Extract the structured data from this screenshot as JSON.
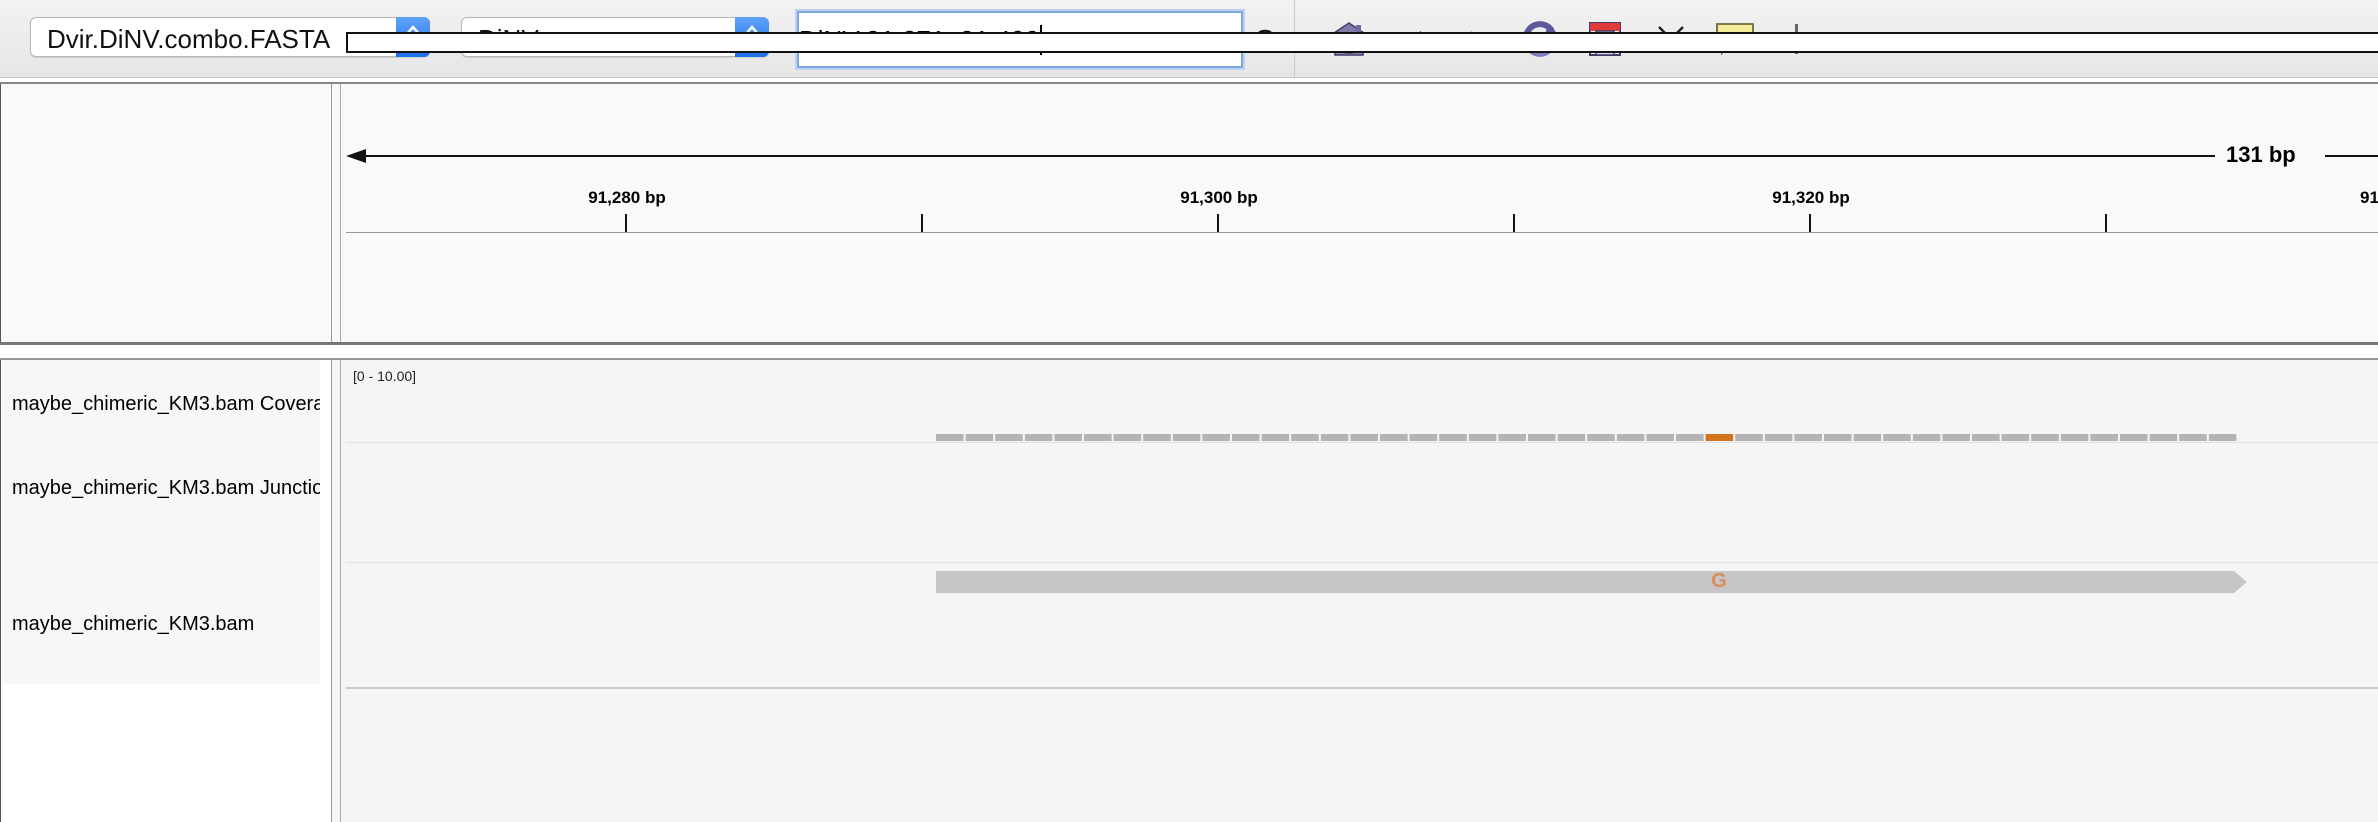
{
  "toolbar": {
    "genome_select": "Dvir.DiNV.combo.FASTA",
    "chromosome_select": "DiNV",
    "locus_value": "DiNV:91,271–91,400",
    "go_label": "Go",
    "icons": [
      "home-icon",
      "back-arrow-icon",
      "forward-arrow-icon",
      "refresh-icon",
      "region-of-interest-icon",
      "fit-to-window-icon",
      "popup-info-icon"
    ]
  },
  "ruler": {
    "span_label": "131 bp",
    "tick_labels": [
      "91,280 bp",
      "91,300 bp",
      "91,320 bp",
      "91"
    ]
  },
  "tracks": {
    "coverage_name": "maybe_chimeric_KM3.bam Covera",
    "coverage_range": "[0 - 10.00]",
    "junctions_name": "maybe_chimeric_KM3.bam Junctio",
    "alignment_name": "maybe_chimeric_KM3.bam"
  },
  "alignment": {
    "mismatch_base": "G"
  },
  "colors": {
    "coverage_gray": "#b4b4b4",
    "mismatch_orange": "#d4731d",
    "read_gray": "#c6c6c6",
    "combo_blue": "#3a8af2"
  }
}
